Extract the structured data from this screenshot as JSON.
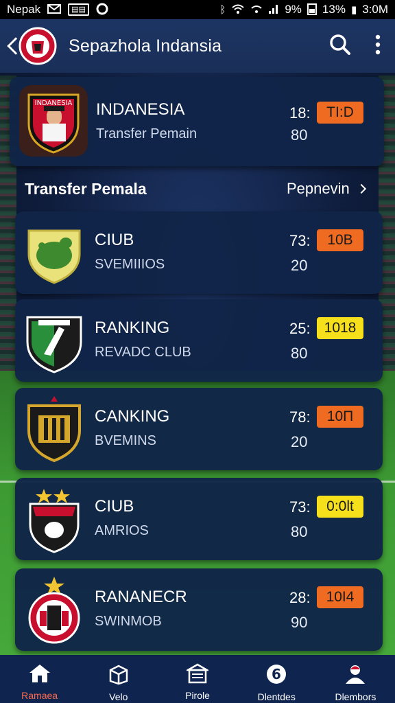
{
  "status_bar": {
    "carrier": "Nepak",
    "battery_text": "9%",
    "signal_text": "13%",
    "time": "3:0M"
  },
  "app_bar": {
    "title": "Sepazhola Indansia"
  },
  "featured": {
    "name": "INDANESIA",
    "subtitle": "Transfer Pemain",
    "crest_text": "INDANESIA",
    "num1": "18:",
    "num2": "80",
    "badge": "TI:D",
    "badge_color": "#ef6b21"
  },
  "section": {
    "title": "Transfer Pemala",
    "link": "Pepnevin"
  },
  "rows": [
    {
      "name": "CIUB",
      "subtitle": "SVEMIIIOS",
      "num1": "73:",
      "num2": "20",
      "badge": "10B",
      "badge_color": "#ef6b21"
    },
    {
      "name": "RANKING",
      "subtitle": "REVADC CLUB",
      "num1": "25:",
      "num2": "80",
      "badge": "1018",
      "badge_color": "#f6e01b"
    },
    {
      "name": "CANKING",
      "subtitle": "BVEMINS",
      "num1": "78:",
      "num2": "20",
      "badge": "10П",
      "badge_color": "#ef6b21"
    },
    {
      "name": "CIUB",
      "subtitle": "AMRIOS",
      "num1": "73:",
      "num2": "80",
      "badge": "0:0lt",
      "badge_color": "#f6e01b"
    },
    {
      "name": "RANANECR",
      "subtitle": "SWINMOB",
      "num1": "28:",
      "num2": "90",
      "badge": "10I4",
      "badge_color": "#ef6b21"
    }
  ],
  "bottom_nav": [
    {
      "label": "Ramaea",
      "icon": "home-icon",
      "active": true
    },
    {
      "label": "Velo",
      "icon": "box-icon",
      "active": false
    },
    {
      "label": "Pirole",
      "icon": "store-icon",
      "active": false
    },
    {
      "label": "Dlentdes",
      "icon": "shield-number-icon",
      "active": false
    },
    {
      "label": "Dlembors",
      "icon": "profile-icon",
      "active": false
    }
  ]
}
